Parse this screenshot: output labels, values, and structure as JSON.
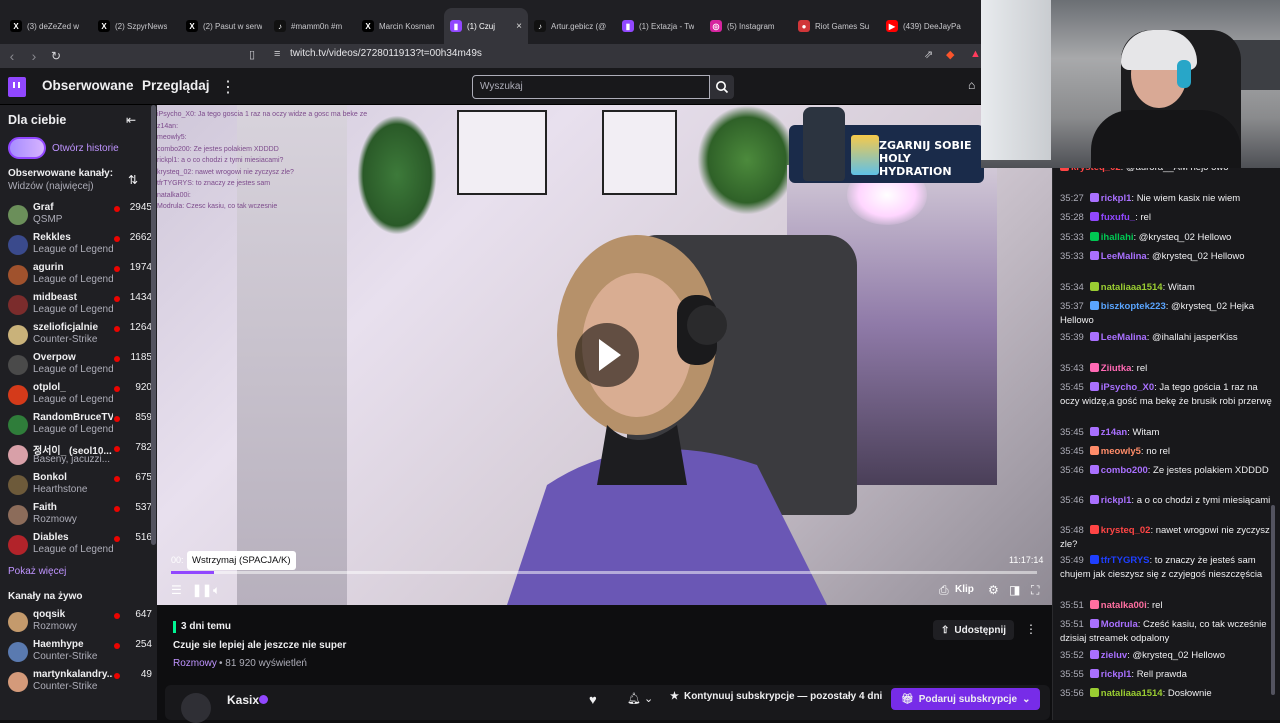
{
  "browser": {
    "tabs": [
      {
        "icon": "x-icon",
        "title": "(3) deZeZed w"
      },
      {
        "icon": "x-icon",
        "title": "(2) SzpyrNews"
      },
      {
        "icon": "x-icon",
        "title": "(2) Pasut w serw"
      },
      {
        "icon": "tiktok-icon",
        "title": "#mamm0n #m"
      },
      {
        "icon": "x-icon",
        "title": "Marcin Kosman"
      },
      {
        "icon": "twitch-icon",
        "title": "(1) Czuj",
        "active": true
      },
      {
        "icon": "tiktok-icon",
        "title": "Artur.gebicz (@"
      },
      {
        "icon": "twitch-icon",
        "title": "(1) Extazja - Tw"
      },
      {
        "icon": "instagram-icon",
        "title": "(5) Instagram"
      },
      {
        "icon": "riot-icon",
        "title": "Riot Games Su"
      },
      {
        "icon": "youtube-icon",
        "title": "(439) DeeJayPa"
      }
    ],
    "tab_close": "×",
    "url": "twitch.tv/videos/2728011913?t=00h34m49s"
  },
  "topnav": {
    "followed": "Obserwowane",
    "browse": "Przeglądaj",
    "more": "⋮",
    "search_placeholder": "Wyszukaj"
  },
  "sidebar": {
    "title": "Dla ciebie",
    "history_link": "Otwórz historie",
    "followed_header": "Obserwowane kanały:",
    "followed_sort": "Widzów (najwięcej)",
    "channels": [
      {
        "name": "Graf",
        "game": "QSMP",
        "viewers": "2945",
        "color": "#6b8f5a"
      },
      {
        "name": "Rekkles",
        "game": "League of Legends",
        "viewers": "2662",
        "color": "#3a4a8c"
      },
      {
        "name": "agurin",
        "game": "League of Legends",
        "viewers": "1974",
        "color": "#a0522d"
      },
      {
        "name": "midbeast",
        "game": "League of Legends",
        "viewers": "1434",
        "color": "#7b2c2c"
      },
      {
        "name": "szelioficjalnie",
        "game": "Counter-Strike",
        "viewers": "1264",
        "color": "#c9b27a"
      },
      {
        "name": "Overpow",
        "game": "League of Legends",
        "viewers": "1185",
        "color": "#4a4a4a"
      },
      {
        "name": "otplol_",
        "game": "League of Legends",
        "viewers": "920",
        "color": "#d43a1a"
      },
      {
        "name": "RandomBruceTV",
        "game": "League of Legends",
        "viewers": "859",
        "color": "#2f7d3a"
      },
      {
        "name": "정서이_ (seol10...",
        "game": "Baseny, jacuzzi...",
        "viewers": "782",
        "color": "#d8a0a8"
      },
      {
        "name": "Bonkol",
        "game": "Hearthstone",
        "viewers": "675",
        "color": "#6d5a3a"
      },
      {
        "name": "Faith",
        "game": "Rozmowy",
        "viewers": "537",
        "color": "#8c6c5a"
      },
      {
        "name": "Diables",
        "game": "League of Legends",
        "viewers": "516",
        "color": "#b2232a"
      }
    ],
    "show_more": "Pokaż więcej",
    "live_header": "Kanały na żywo",
    "live_channels": [
      {
        "name": "qoqsik",
        "game": "Rozmowy",
        "viewers": "647",
        "color": "#c49a6c"
      },
      {
        "name": "Haemhype",
        "game": "Counter-Strike",
        "viewers": "254",
        "color": "#5a7ab0"
      },
      {
        "name": "martynkalandry...",
        "game": "Counter-Strike",
        "viewers": "49",
        "color": "#d49a7a"
      }
    ]
  },
  "video": {
    "overlay_chat": [
      "iPsycho_X0: Ja tego goscia 1 raz na oczy widze a gosc ma beke ze",
      "z14an:",
      "meowly5:",
      "combo200: Ze jestes polakiem XDDDD",
      "rickpl1: a o co chodzi z tymi miesiacami?",
      "krysteq_02: nawet wrogowi nie zyczysz zle?",
      "tfrTYGRYS: to znaczy ze jestes sam",
      "natalka00i:",
      "Modrula: Czesc kasiu, co tak wczesnie"
    ],
    "promo_text": "ZGARNIJ SOBIE HOLY HYDRATION",
    "current_time": "00:",
    "total_time": "11:17:14",
    "tooltip": "Wstrzymaj (SPACJA/K)",
    "progress": 0.05,
    "clip_label": "Klip"
  },
  "info": {
    "date": "3 dni temu",
    "title": "Czuje sie lepiej ale jeszcze nie super",
    "category": "Rozmowy",
    "views": "• 81 920 wyświetleń",
    "share": "Udostępnij",
    "channel_name": "Kasix",
    "subscribe_text": "Kontynuuj subskrypcje — pozostały 4 dni",
    "gift_text": "Podaruj subskrypcje"
  },
  "chat": {
    "messages": [
      {
        "ts": "",
        "user": "krysteq_02",
        "color": "#ff4545",
        "text": ": @aurora__AM hejo owo"
      },
      {
        "ts": "35:27",
        "user": "rickpl1",
        "color": "#a970ff",
        "text": ": Nie wiem kasix nie wiem"
      },
      {
        "ts": "35:28",
        "user": "fuxufu_",
        "color": "#9147ff",
        "text": ": rel"
      },
      {
        "ts": "35:33",
        "user": "ihallahi",
        "color": "#00c853",
        "text": ": @krysteq_02 Hellowo"
      },
      {
        "ts": "35:33",
        "user": "LeeMalina",
        "color": "#a970ff",
        "text": ": @krysteq_02 Hellowo"
      },
      {
        "ts": "35:34",
        "user": "nataliaaa1514",
        "color": "#9acd32",
        "text": ": Witam"
      },
      {
        "ts": "35:37",
        "user": "biszkoptek223",
        "color": "#5aa5ff",
        "text": ": @krysteq_02 Hejka Hellowo"
      },
      {
        "ts": "35:39",
        "user": "LeeMalina",
        "color": "#a970ff",
        "text": ": @ihallahi jasperKiss"
      },
      {
        "ts": "35:43",
        "user": "Ziiutka",
        "color": "#ff69b4",
        "text": ": rel"
      },
      {
        "ts": "35:45",
        "user": "iPsycho_X0",
        "color": "#a970ff",
        "text": ": Ja tego gościa 1 raz na oczy widzę,a gość ma bekę że brusik robi przerwę"
      },
      {
        "ts": "35:45",
        "user": "z14an",
        "color": "#a970ff",
        "text": ": Witam"
      },
      {
        "ts": "35:45",
        "user": "meowly5",
        "color": "#ff8c69",
        "text": ": no rel"
      },
      {
        "ts": "35:46",
        "user": "combo200",
        "color": "#a970ff",
        "text": ": Ze jestes polakiem XDDDD"
      },
      {
        "ts": "35:46",
        "user": "rickpl1",
        "color": "#a970ff",
        "text": ": a o co chodzi z tymi miesiącami"
      },
      {
        "ts": "35:48",
        "user": "krysteq_02",
        "color": "#ff4545",
        "text": ": nawet wrogowi nie zyczysz zle?"
      },
      {
        "ts": "35:49",
        "user": "tfrTYGRYS",
        "color": "#1f3fff",
        "text": ": to znaczy że jesteś sam chujem jak cieszysz się z czyjegoś nieszczęścia"
      },
      {
        "ts": "35:51",
        "user": "natalka00i",
        "color": "#ff6fa0",
        "text": ": rel"
      },
      {
        "ts": "35:51",
        "user": "Modrula",
        "color": "#a970ff",
        "text": ": Cześć kasiu, co tak wcześnie dzisiaj streamek odpalony"
      },
      {
        "ts": "35:52",
        "user": "zieluv",
        "color": "#a970ff",
        "text": ": @krysteq_02 Hellowo"
      },
      {
        "ts": "35:55",
        "user": "rickpl1",
        "color": "#a970ff",
        "text": ": Rell prawda"
      },
      {
        "ts": "35:56",
        "user": "nataliaaa1514",
        "color": "#9acd32",
        "text": ": Dosłownie"
      }
    ]
  }
}
